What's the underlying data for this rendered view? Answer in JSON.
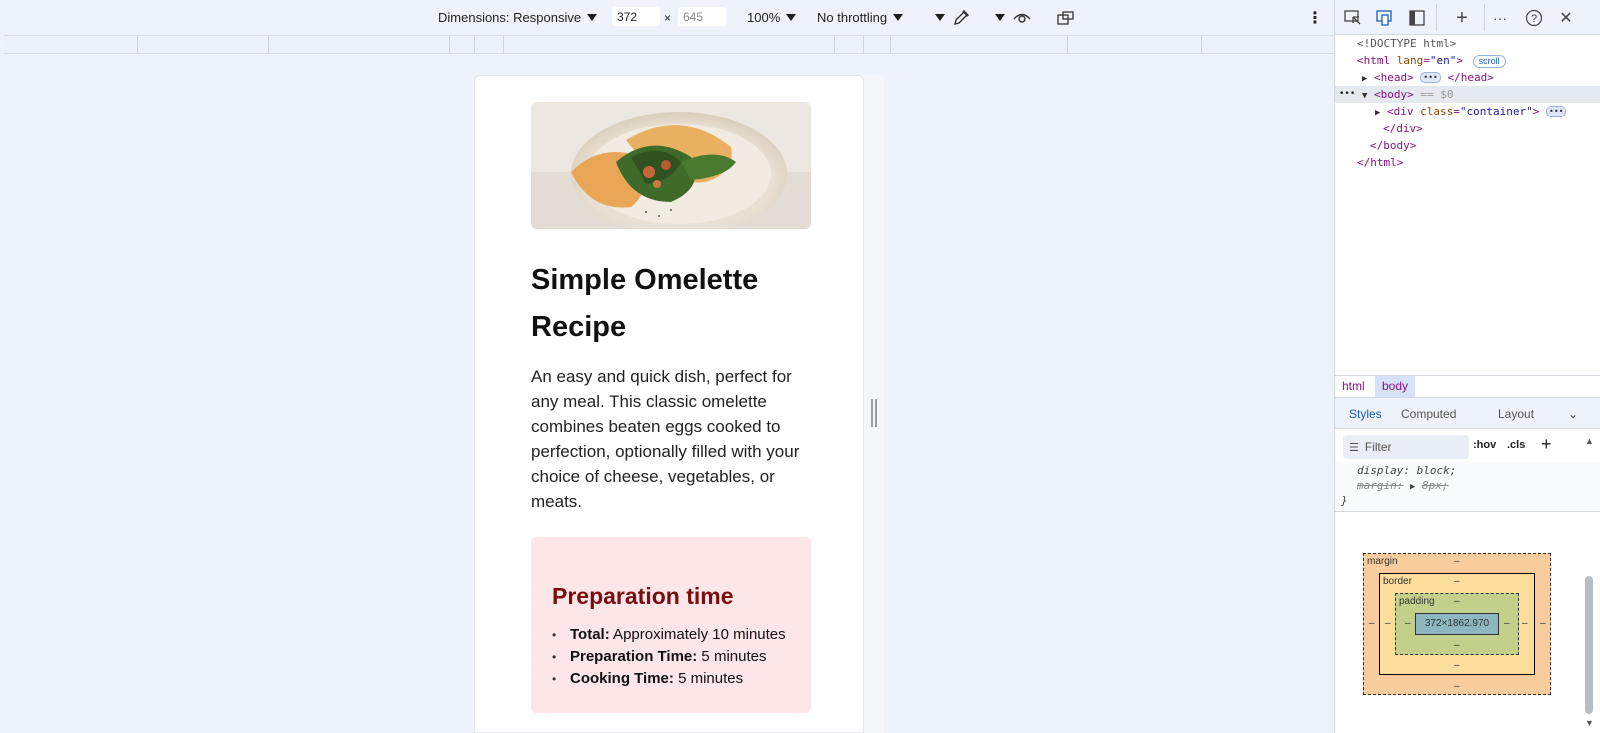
{
  "device_toolbar": {
    "dimensions_label": "Dimensions: Responsive",
    "width_value": "372",
    "times": "×",
    "height_value": "645",
    "zoom": "100%",
    "throttling": "No throttling"
  },
  "page": {
    "title": "Simple Omelette Recipe",
    "description": "An easy and quick dish, perfect for any meal. This classic omelette combines beaten eggs cooked to perfection, optionally filled with your choice of cheese, vegetables, or meats.",
    "prep": {
      "heading": "Preparation time",
      "items": [
        {
          "label": "Total:",
          "value": " Approximately 10 minutes"
        },
        {
          "label": "Preparation Time:",
          "value": " 5 minutes"
        },
        {
          "label": "Cooking Time:",
          "value": " 5 minutes"
        }
      ]
    }
  },
  "devtools": {
    "dom": {
      "doctype": "<!DOCTYPE html>",
      "html_open_tag": "<html",
      "html_attr_name": "lang",
      "html_attr_value": "\"en\"",
      "html_open_end": ">",
      "scroll_badge": "scroll",
      "head_open": "<head>",
      "head_close": "</head>",
      "body_open": "<body>",
      "body_marker": "== $0",
      "div_open": "<div",
      "div_attr_name": "class",
      "div_attr_value": "\"container\"",
      "div_open_end": ">",
      "div_close": "</div>",
      "body_close": "</body>",
      "html_close": "</html>",
      "ellipsis": "•••"
    },
    "breadcrumbs": [
      "html",
      "body"
    ],
    "tabs": [
      "Styles",
      "Computed",
      "Layout"
    ],
    "filter_placeholder": "Filter",
    "hov": ":hov",
    "cls": ".cls",
    "styles_lines": {
      "display": "display: block;",
      "margin_prop": "margin:",
      "margin_value": "8px;",
      "close_brace": "}"
    },
    "box_model": {
      "margin_label": "margin",
      "border_label": "border",
      "padding_label": "padding",
      "dash": "–",
      "content_size": "372×1862.970"
    }
  },
  "colors": {
    "accent": "#1a5fc0",
    "prep_bg": "#fde6e7",
    "prep_heading": "#7a0d0d"
  }
}
